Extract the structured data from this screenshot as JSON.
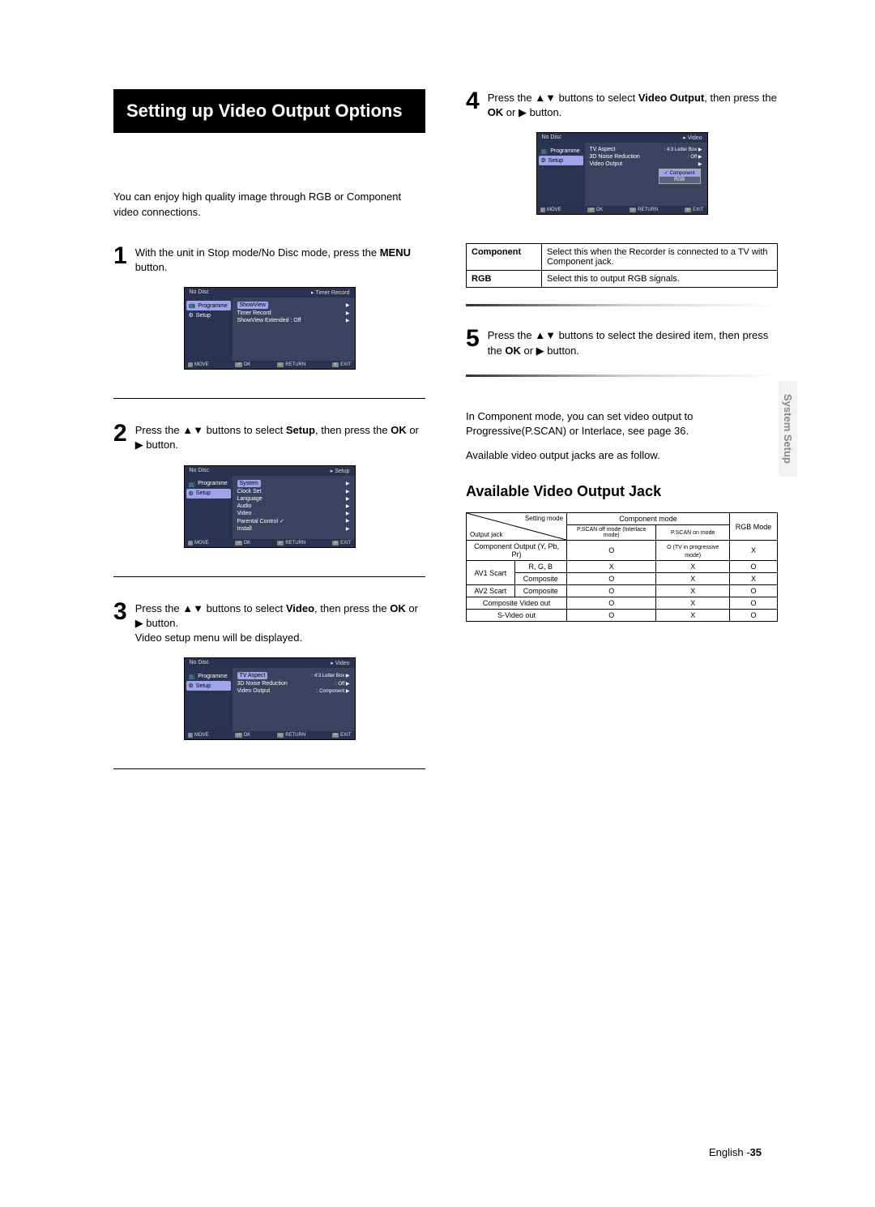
{
  "title": "Setting up Video Output Options",
  "intro": "You can enjoy high quality image through RGB or Component video connections.",
  "side_tab": "System Setup",
  "footer": {
    "lang": "English -",
    "page": "35"
  },
  "steps": {
    "s1": {
      "num": "1",
      "pre": "With the unit in Stop mode/No Disc mode, press the ",
      "bold": "MENU",
      "post": " button."
    },
    "s2": {
      "num": "2",
      "pre": "Press the ",
      "mid1": " buttons to select ",
      "bold1": "Setup",
      "mid2": ", then press the ",
      "bold2": "OK",
      "post": " or ▶ button."
    },
    "s3": {
      "num": "3",
      "pre": "Press the ",
      "mid1": " buttons to select ",
      "bold1": "Video",
      "mid2": ", then press the ",
      "bold2": "OK",
      "post": " or ▶ button.",
      "sub": "Video setup menu will be displayed."
    },
    "s4": {
      "num": "4",
      "pre": "Press the ",
      "mid1": " buttons to select ",
      "bold1": "Video Output",
      "mid2": ", then press the ",
      "bold2": "OK",
      "post": " or ▶ button."
    },
    "s5": {
      "num": "5",
      "pre": "Press the ",
      "mid1": " buttons to select the desired item, then press the ",
      "bold2": "OK",
      "post": " or ▶ button."
    }
  },
  "arrows": "▲▼",
  "osd_common": {
    "no_disc": "No Disc",
    "programme": "Programme",
    "setup": "Setup",
    "move": "MOVE",
    "ok": "OK",
    "return": "RETURN",
    "exit": "EXIT"
  },
  "osd1": {
    "crumb": "Timer Record",
    "rows": [
      {
        "l": "ShowView",
        "r": "▶"
      },
      {
        "l": "Timer Record",
        "r": "▶"
      },
      {
        "l": "ShowView Extended : Off",
        "r": "▶"
      }
    ]
  },
  "osd2": {
    "crumb": "Setup",
    "rows": [
      {
        "l": "System",
        "r": "▶",
        "hl": true
      },
      {
        "l": "Clock Set",
        "r": "▶"
      },
      {
        "l": "Language",
        "r": "▶"
      },
      {
        "l": "Audio",
        "r": "▶"
      },
      {
        "l": "Video",
        "r": "▶"
      },
      {
        "l": "Parental Control ✓",
        "r": "▶"
      },
      {
        "l": "Install",
        "r": "▶"
      }
    ]
  },
  "osd3": {
    "crumb": "Video",
    "rows": [
      {
        "l": "TV Aspect",
        "r": ": 4:3 Letter Box ▶",
        "hl": true
      },
      {
        "l": "3D Noise Reduction",
        "r": ": Off        ▶"
      },
      {
        "l": "Video Output",
        "r": ": Component ▶"
      }
    ]
  },
  "osd4": {
    "crumb": "Video",
    "rows": [
      {
        "l": "TV Aspect",
        "r": ": 4:3 Letter Box ▶"
      },
      {
        "l": "3D Noise Reduction",
        "r": ": Off        ▶"
      },
      {
        "l": "Video Output",
        "r": "           ▶"
      }
    ],
    "dropdown": [
      "Component",
      "RGB"
    ],
    "dropdown_sel": 0
  },
  "table1": [
    {
      "h": "Component",
      "t": "Select this when the Recorder is connected to a TV with Component jack."
    },
    {
      "h": "RGB",
      "t": "Select this to output RGB signals."
    }
  ],
  "para1": "In Component mode, you can set video output to Progressive(P.SCAN) or Interlace, see page 36.",
  "para2": "Available video output jacks are as follow.",
  "subheading": "Available Video Output Jack",
  "chart_data": {
    "type": "table",
    "diag_top": "Setting mode",
    "diag_left": "Output jack",
    "col_group": "Component mode",
    "cols": [
      "P.SCAN off mode (Interlace mode)",
      "P.SCAN on mode",
      "RGB Mode"
    ],
    "rows": [
      {
        "label": "Component Output (Y, Pb, Pr)",
        "cells": [
          "O",
          "O (TV in progressive mode)",
          "X"
        ]
      },
      {
        "label": "AV1 Scart — R, G, B",
        "cells": [
          "X",
          "X",
          "O"
        ]
      },
      {
        "label": "AV1 Scart — Composite",
        "cells": [
          "O",
          "X",
          "X"
        ]
      },
      {
        "label": "AV2 Scart — Composite",
        "cells": [
          "O",
          "X",
          "O"
        ]
      },
      {
        "label": "Composite Video out",
        "cells": [
          "O",
          "X",
          "O"
        ]
      },
      {
        "label": "S-Video out",
        "cells": [
          "O",
          "X",
          "O"
        ]
      }
    ]
  }
}
